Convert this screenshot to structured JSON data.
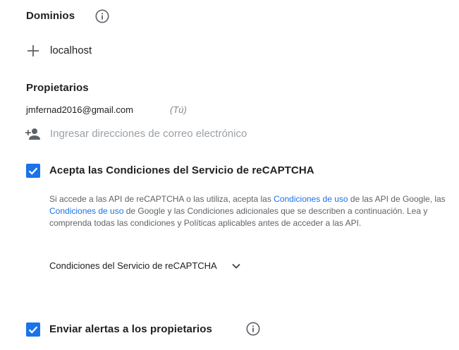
{
  "domains": {
    "title": "Dominios",
    "items": [
      "localhost"
    ]
  },
  "owners": {
    "title": "Propietarios",
    "items": [
      {
        "email": "jmfernad2016@gmail.com",
        "note": "(Tú)"
      }
    ],
    "add_placeholder": "Ingresar direcciones de correo electrónico"
  },
  "terms": {
    "checkbox_label": "Acepta las Condiciones del Servicio de reCAPTCHA",
    "checked": true,
    "paragraph": {
      "part1": "Si accede a las API de reCAPTCHA o las utiliza, acepta las ",
      "link1": "Condiciones de uso",
      "part2": " de las API de Google, las ",
      "link2": "Condiciones de uso",
      "part3": " de Google y las Condiciones adicionales que se describen a continuación. Lea y comprenda todas las condiciones y Políticas aplicables antes de acceder a las API."
    },
    "dropdown_label": "Condiciones del Servicio de reCAPTCHA"
  },
  "alerts": {
    "checkbox_label": "Enviar alertas a los propietarios",
    "checked": true
  },
  "colors": {
    "accent": "#1a73e8",
    "text": "#202124",
    "muted": "#5f6368",
    "placeholder": "#9aa0a6"
  },
  "icons": {
    "info": "info-circle-icon",
    "add": "plus-icon",
    "add_person": "person-add-icon",
    "check": "check-icon",
    "chevron": "chevron-down-icon"
  }
}
